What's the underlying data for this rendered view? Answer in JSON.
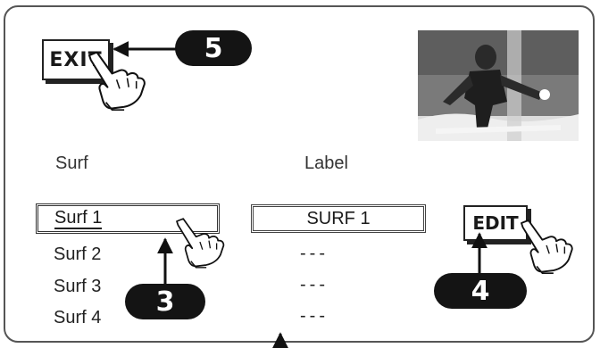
{
  "buttons": {
    "exit": "EXIT",
    "edit": "EDIT"
  },
  "columns": {
    "surf": "Surf",
    "label": "Label"
  },
  "surf_list": [
    "Surf 1",
    "Surf 2",
    "Surf 3",
    "Surf 4"
  ],
  "labels": [
    "SURF 1",
    "---",
    "---",
    "---"
  ],
  "callouts": {
    "step3": "3",
    "step4": "4",
    "step5": "5"
  }
}
